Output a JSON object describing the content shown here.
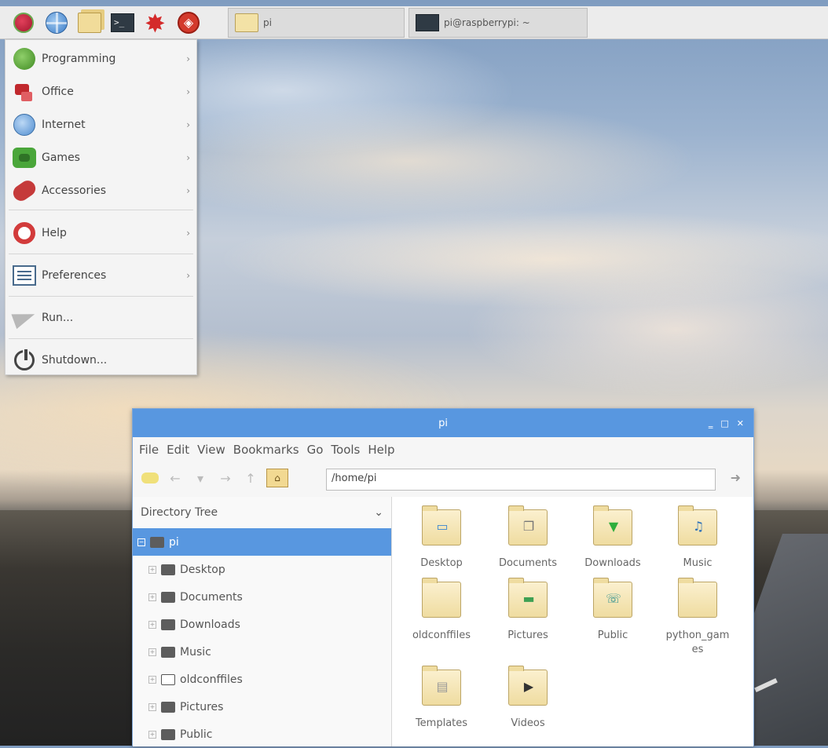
{
  "taskbar": {
    "launchers": [
      {
        "icon": "raspberry-menu-icon"
      },
      {
        "icon": "web-browser-icon"
      },
      {
        "icon": "file-manager-icon"
      },
      {
        "icon": "terminal-icon"
      },
      {
        "icon": "wolfram-icon"
      },
      {
        "icon": "mathematica-icon"
      }
    ],
    "tasks": [
      {
        "label": "pi",
        "icon": "folder-icon"
      },
      {
        "label": "pi@raspberrypi: ~",
        "icon": "terminal-icon"
      }
    ]
  },
  "start_menu": {
    "items": [
      {
        "label": "Programming",
        "icon": "programming-icon",
        "submenu": true
      },
      {
        "label": "Office",
        "icon": "office-icon",
        "submenu": true
      },
      {
        "label": "Internet",
        "icon": "internet-icon",
        "submenu": true
      },
      {
        "label": "Games",
        "icon": "games-icon",
        "submenu": true
      },
      {
        "label": "Accessories",
        "icon": "accessories-icon",
        "submenu": true
      },
      {
        "label": "Help",
        "icon": "help-icon",
        "submenu": true
      },
      {
        "label": "Preferences",
        "icon": "preferences-icon",
        "submenu": true
      },
      {
        "label": "Run...",
        "icon": "run-icon",
        "submenu": false
      },
      {
        "label": "Shutdown...",
        "icon": "shutdown-icon",
        "submenu": false
      }
    ],
    "arrow": "›"
  },
  "file_manager": {
    "title": "pi",
    "controls": {
      "minimize": "‗",
      "maximize": "□",
      "close": "✕"
    },
    "menu": [
      "File",
      "Edit",
      "View",
      "Bookmarks",
      "Go",
      "Tools",
      "Help"
    ],
    "path": "/home/pi",
    "sidebar": {
      "mode": "Directory Tree",
      "items": [
        {
          "label": "pi",
          "selected": true
        },
        {
          "label": "Desktop"
        },
        {
          "label": "Documents"
        },
        {
          "label": "Downloads"
        },
        {
          "label": "Music"
        },
        {
          "label": "oldconffiles"
        },
        {
          "label": "Pictures"
        },
        {
          "label": "Public"
        }
      ]
    },
    "files": [
      {
        "label": "Desktop",
        "emblem": "▭"
      },
      {
        "label": "Documents",
        "emblem": "❐"
      },
      {
        "label": "Downloads",
        "emblem": "▼"
      },
      {
        "label": "Music",
        "emblem": "♫"
      },
      {
        "label": "oldconffiles",
        "emblem": ""
      },
      {
        "label": "Pictures",
        "emblem": "▬"
      },
      {
        "label": "Public",
        "emblem": "☏"
      },
      {
        "label": "python_gam\nes",
        "emblem": ""
      },
      {
        "label": "Templates",
        "emblem": "▤"
      },
      {
        "label": "Videos",
        "emblem": "▶"
      }
    ]
  },
  "colors": {
    "accent": "#5897e0",
    "folder": "#efdca0"
  }
}
